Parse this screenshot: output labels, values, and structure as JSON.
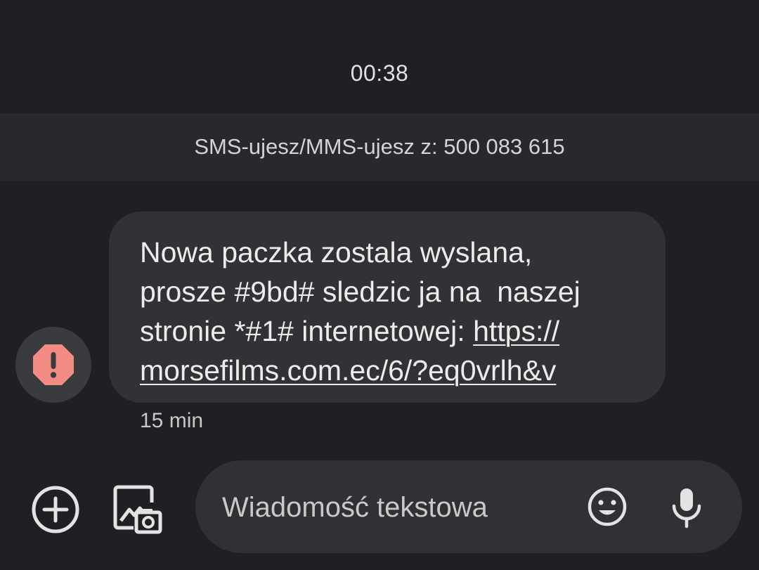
{
  "conversation": {
    "timestamp": "00:38",
    "sender_banner": "SMS-ujesz/MMS-ujesz z: 500 083 615"
  },
  "message": {
    "avatar_icon": "warning-octagon-icon",
    "avatar_color": "#f28b82",
    "text": "Nowa paczka zostala wyslana,\nprosze #9bd# sledzic ja na  naszej\nstronie *#1# internetowej: ",
    "link": "https://\nmorsefilms.com.ec/6/?eq0vrlh&v",
    "time": "15 min"
  },
  "composer": {
    "placeholder": "Wiadomość tekstowa",
    "value": "",
    "add_icon": "add-circle-icon",
    "gallery_icon": "gallery-camera-icon",
    "emoji_icon": "emoji-icon",
    "mic_icon": "microphone-icon"
  }
}
